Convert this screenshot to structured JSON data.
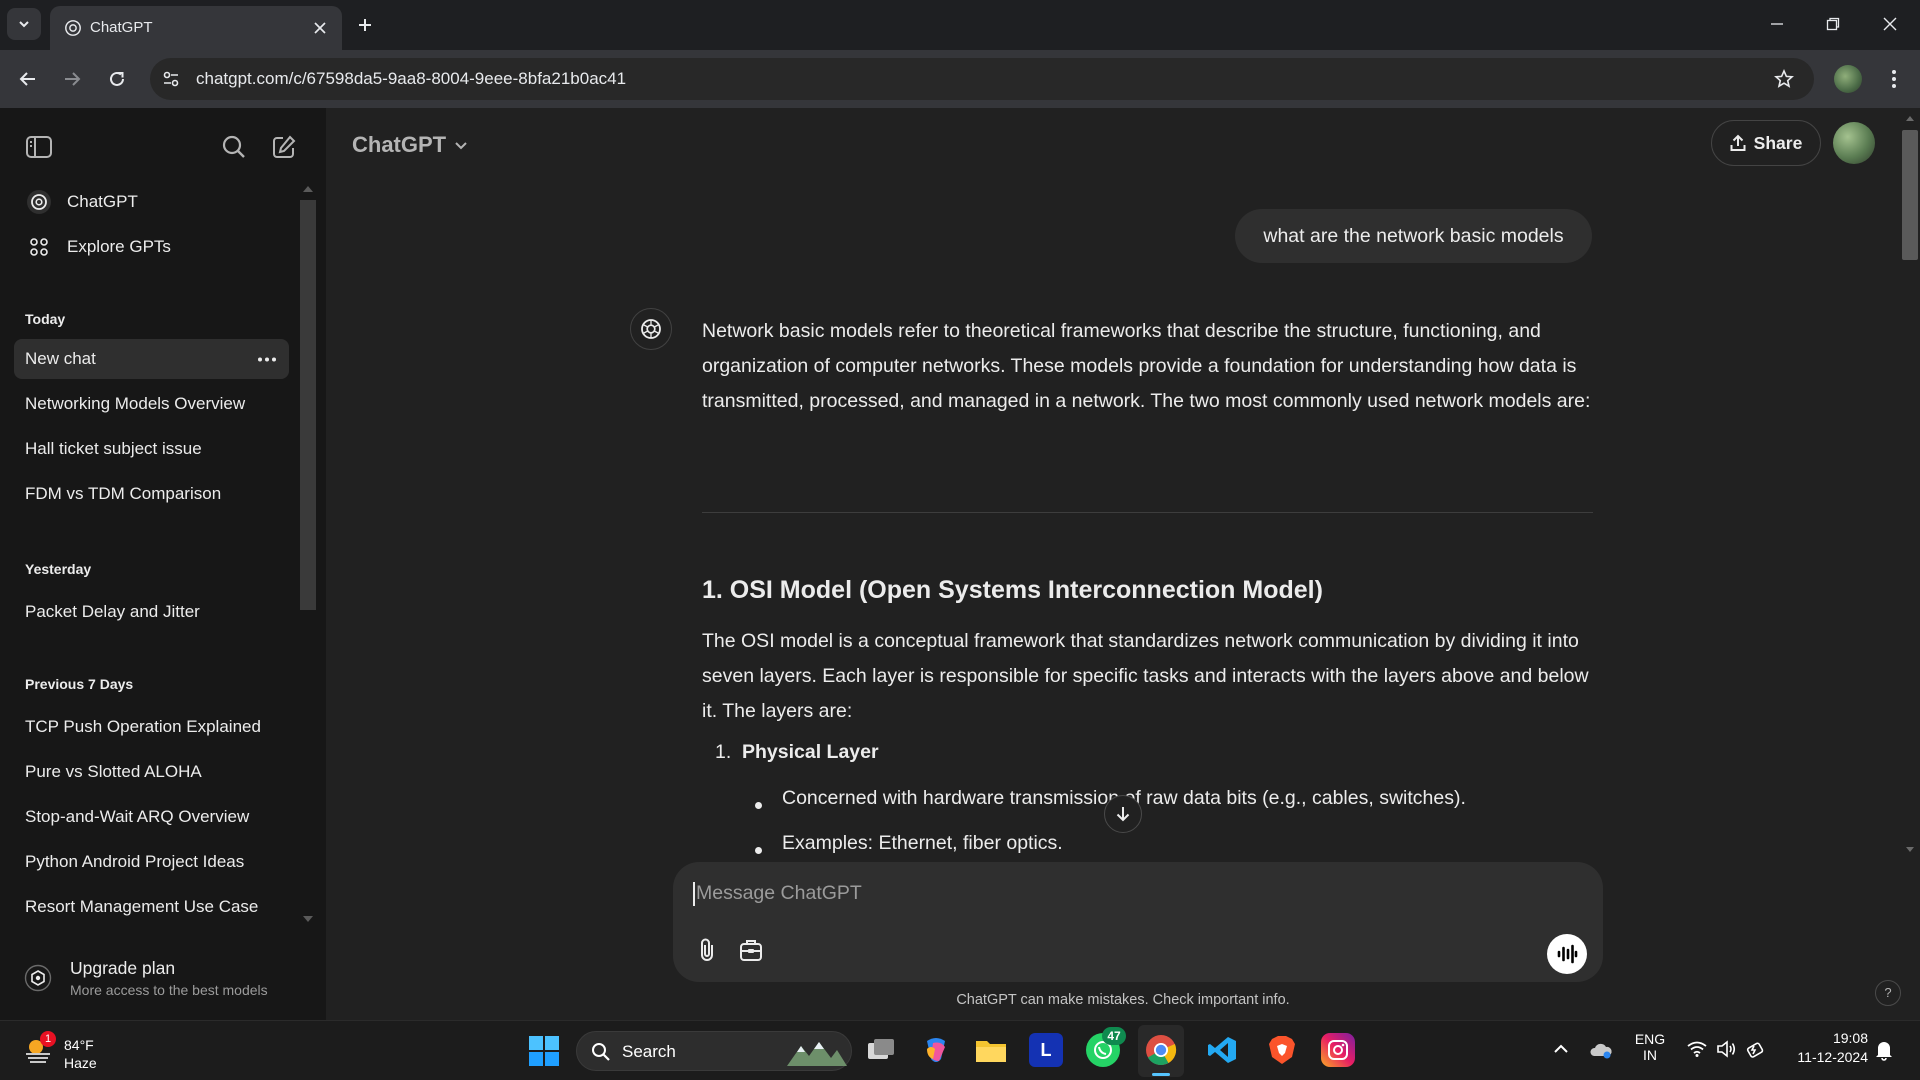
{
  "browser": {
    "tab_title": "ChatGPT",
    "url": "chatgpt.com/c/67598da5-9aa8-8004-9eee-8bfa21b0ac41"
  },
  "sidebar": {
    "top_items": [
      {
        "label": "ChatGPT"
      },
      {
        "label": "Explore GPTs"
      }
    ],
    "groups": [
      {
        "heading": "Today",
        "items": [
          "New chat",
          "Networking Models Overview",
          "Hall ticket subject issue",
          "FDM vs TDM Comparison"
        ]
      },
      {
        "heading": "Yesterday",
        "items": [
          "Packet Delay and Jitter"
        ]
      },
      {
        "heading": "Previous 7 Days",
        "items": [
          "TCP Push Operation Explained",
          "Pure vs Slotted ALOHA",
          "Stop-and-Wait ARQ Overview",
          "Python Android Project Ideas",
          "Resort Management Use Case"
        ]
      }
    ],
    "upgrade": {
      "title": "Upgrade plan",
      "subtitle": "More access to the best models"
    }
  },
  "header": {
    "model_label": "ChatGPT",
    "share_label": "Share"
  },
  "conversation": {
    "user_message": "what are the network basic models",
    "intro": "Network basic models refer to theoretical frameworks that describe the structure, functioning, and organization of computer networks. These models provide a foundation for understanding how data is transmitted, processed, and managed in a network. The two most commonly used network models are:",
    "section_heading": "1. OSI Model (Open Systems Interconnection Model)",
    "section_text": "The OSI model is a conceptual framework that standardizes network communication by dividing it into seven layers. Each layer is responsible for specific tasks and interacts with the layers above and below it. The layers are:",
    "list_number": "1.",
    "list_title": "Physical Layer",
    "bullets": [
      "Concerned with hardware transmission of raw data bits (e.g., cables, switches).",
      "Examples: Ethernet, fiber optics."
    ]
  },
  "composer": {
    "placeholder": "Message ChatGPT",
    "disclaimer": "ChatGPT can make mistakes. Check important info.",
    "help": "?"
  },
  "taskbar": {
    "weather_temp": "84°F",
    "weather_desc": "Haze",
    "weather_badge": "1",
    "search_label": "Search",
    "whatsapp_badge": "47",
    "lang_line1": "ENG",
    "lang_line2": "IN",
    "time": "19:08",
    "date": "11-12-2024"
  },
  "colors": {
    "accent": "#ececec",
    "background": "#212121",
    "sidebar": "#171717"
  }
}
